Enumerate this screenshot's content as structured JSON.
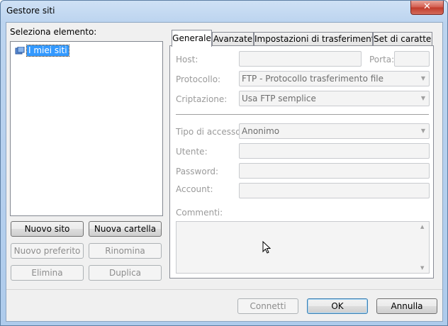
{
  "window": {
    "title": "Gestore siti",
    "close_glyph": "✕"
  },
  "left": {
    "select_label": "Seleziona elemento:",
    "tree": [
      {
        "label": "I miei siti",
        "icon": "sites-folder-icon"
      }
    ],
    "buttons": {
      "new_site": "Nuovo sito",
      "new_folder": "Nuova cartella",
      "new_bookmark": "Nuovo preferito",
      "rename": "Rinomina",
      "delete": "Elimina",
      "duplicate": "Duplica"
    }
  },
  "tabs": [
    "Generale",
    "Avanzate",
    "Impostazioni di trasferimento",
    "Set di caratteri"
  ],
  "general": {
    "host_label": "Host:",
    "port_label": "Porta:",
    "protocol_label": "Protocollo:",
    "protocol_value": "FTP - Protocollo trasferimento file",
    "encryption_label": "Criptazione:",
    "encryption_value": "Usa FTP semplice",
    "logon_label": "Tipo di accesso:",
    "logon_value": "Anonimo",
    "user_label": "Utente:",
    "password_label": "Password:",
    "account_label": "Account:",
    "comments_label": "Commenti:"
  },
  "footer": {
    "connect": "Connetti",
    "ok": "OK",
    "cancel": "Annulla"
  },
  "colors": {
    "selection": "#3399ff",
    "title_close": "#c13a2b"
  }
}
